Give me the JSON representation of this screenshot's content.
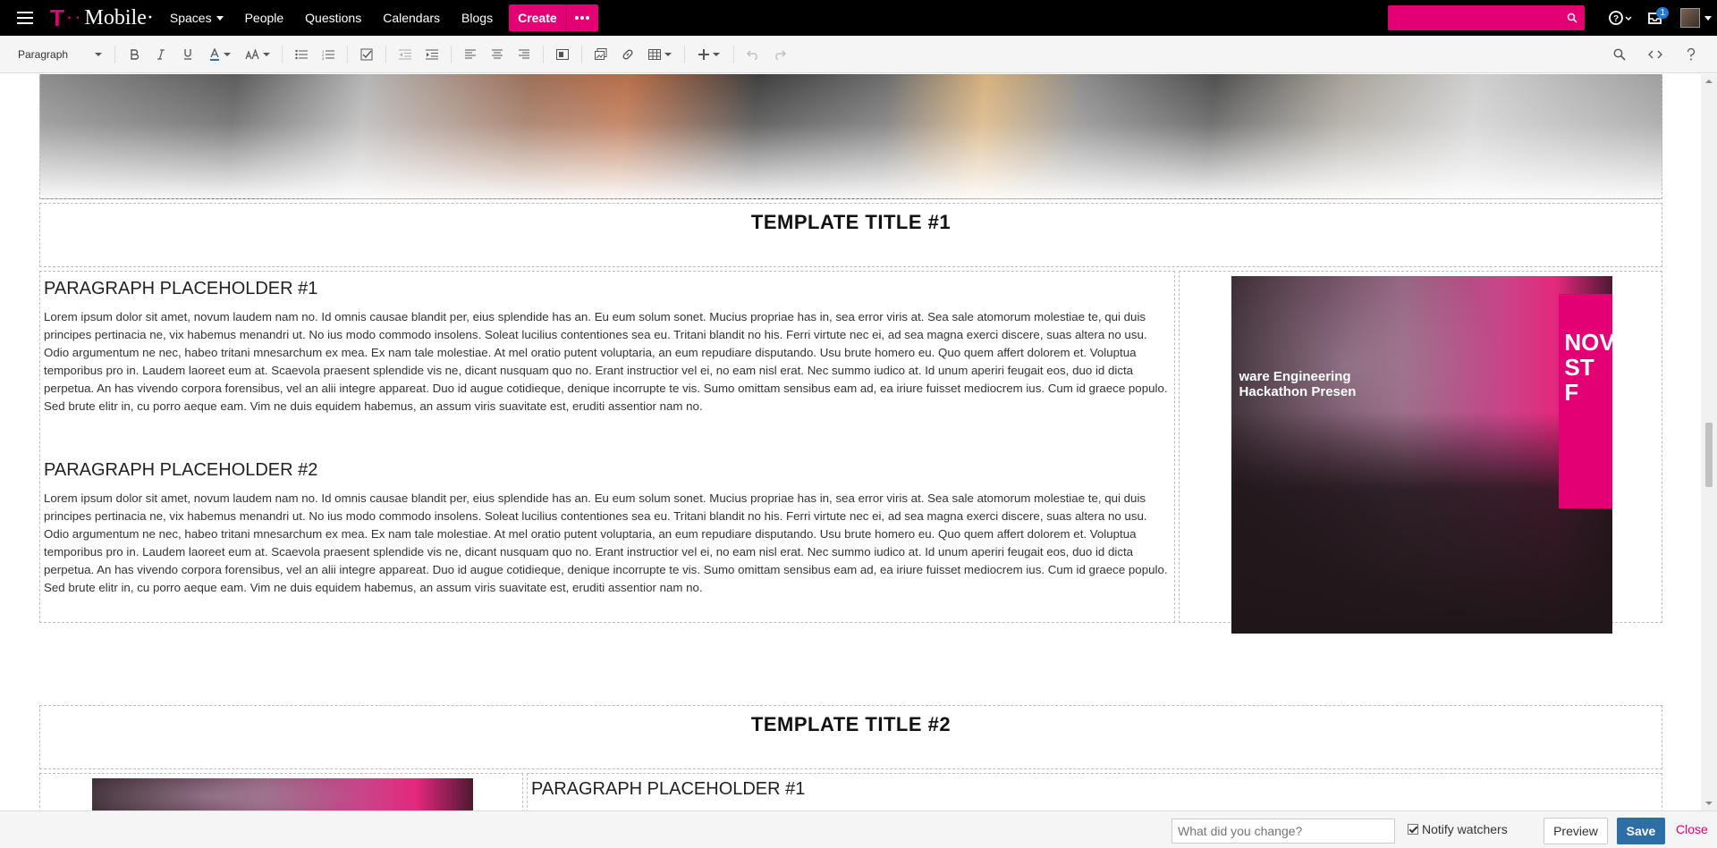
{
  "nav": {
    "logo_t": "T",
    "logo_dots": "··",
    "logo_brand": "Mobile·",
    "items": [
      "Spaces",
      "People",
      "Questions",
      "Calendars",
      "Blogs"
    ],
    "create_label": "Create",
    "notification_count": "1"
  },
  "toolbar": {
    "block_format": "Paragraph"
  },
  "content": {
    "template_title_1": "TEMPLATE TITLE #1",
    "template_title_2": "TEMPLATE TITLE #2",
    "section1": {
      "para1_heading": "PARAGRAPH PLACEHOLDER #1",
      "para1_text": "Lorem ipsum dolor sit amet, novum laudem nam no. Id omnis causae blandit per, eius splendide has an. Eu eum solum sonet. Mucius propriae has in, sea error viris at. Sea sale atomorum molestiae te, qui duis principes pertinacia ne, vix habemus menandri ut. No ius modo commodo insolens. Soleat lucilius contentiones sea eu. Tritani blandit no his. Ferri virtute nec ei, ad sea magna exerci discere, suas altera no usu. Odio argumentum ne nec, habeo tritani mnesarchum ex mea. Ex nam tale molestiae. At mel oratio putent voluptaria, an eum repudiare disputando. Usu brute homero eu. Quo quem affert dolorem et. Voluptua temporibus pro in. Laudem laoreet eum at. Scaevola praesent splendide vis ne, dicant nusquam quo no. Erant instructior vel ei, no eam nisl erat. Nec summo iudico at. Id unum aperiri feugait eos, duo id dicta perpetua. An has vivendo corpora forensibus, vel an alii integre appareat. Duo id augue cotidieque, denique incorrupte te vis. Sumo omittam sensibus eam ad, ea iriure fuisset mediocrem ius. Cum id graece populo. Sed brute elitr in, cu porro aeque eam. Vim ne duis equidem habemus, an assum viris suavitate est, eruditi assentior nam no.",
      "para2_heading": "PARAGRAPH PLACEHOLDER #2",
      "para2_text": "Lorem ipsum dolor sit amet, novum laudem nam no. Id omnis causae blandit per, eius splendide has an. Eu eum solum sonet. Mucius propriae has in, sea error viris at. Sea sale atomorum molestiae te, qui duis principes pertinacia ne, vix habemus menandri ut. No ius modo commodo insolens. Soleat lucilius contentiones sea eu. Tritani blandit no his. Ferri virtute nec ei, ad sea magna exerci discere, suas altera no usu. Odio argumentum ne nec, habeo tritani mnesarchum ex mea. Ex nam tale molestiae. At mel oratio putent voluptaria, an eum repudiare disputando. Usu brute homero eu. Quo quem affert dolorem et. Voluptua temporibus pro in. Laudem laoreet eum at. Scaevola praesent splendide vis ne, dicant nusquam quo no. Erant instructior vel ei, no eam nisl erat. Nec summo iudico at. Id unum aperiri feugait eos, duo id dicta perpetua. An has vivendo corpora forensibus, vel an alii integre appareat. Duo id augue cotidieque, denique incorrupte te vis. Sumo omittam sensibus eam ad, ea iriure fuisset mediocrem ius. Cum id graece populo. Sed brute elitr in, cu porro aeque eam. Vim ne duis equidem habemus, an assum viris suavitate est, eruditi assentior nam no.",
      "photo_caption": "ware Engineering\nHackathon Presen",
      "photo_sign": "NOV\nST\nF"
    },
    "section2": {
      "para1_heading": "PARAGRAPH PLACEHOLDER #1"
    }
  },
  "footer": {
    "change_placeholder": "What did you change?",
    "notify_label": "Notify watchers",
    "preview_label": "Preview",
    "save_label": "Save",
    "close_label": "Close"
  },
  "colors": {
    "brand": "#e20074",
    "save": "#2e6ea6"
  }
}
